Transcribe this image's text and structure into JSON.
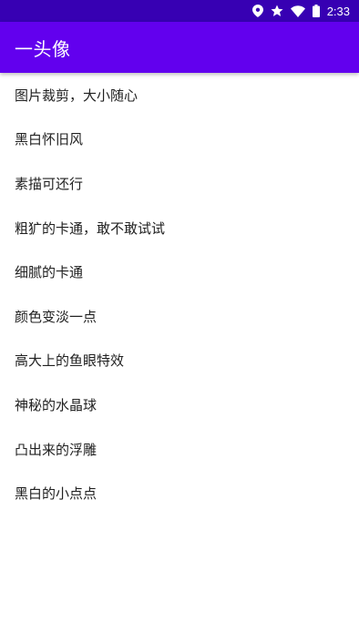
{
  "status_bar": {
    "time": "2:33",
    "icons": [
      "location-icon",
      "star-icon",
      "wifi-icon",
      "battery-icon"
    ]
  },
  "app_bar": {
    "title": "一头像"
  },
  "menu": {
    "items": [
      {
        "label": "图片裁剪，大小随心"
      },
      {
        "label": "黑白怀旧风"
      },
      {
        "label": "素描可还行"
      },
      {
        "label": "粗犷的卡通，敢不敢试试"
      },
      {
        "label": "细腻的卡通"
      },
      {
        "label": "颜色变淡一点"
      },
      {
        "label": "高大上的鱼眼特效"
      },
      {
        "label": "神秘的水晶球"
      },
      {
        "label": "凸出来的浮雕"
      },
      {
        "label": "黑白的小点点"
      }
    ]
  },
  "colors": {
    "status_bar": "#3700b3",
    "app_bar": "#6200ee",
    "text": "#212121",
    "background": "#ffffff"
  }
}
